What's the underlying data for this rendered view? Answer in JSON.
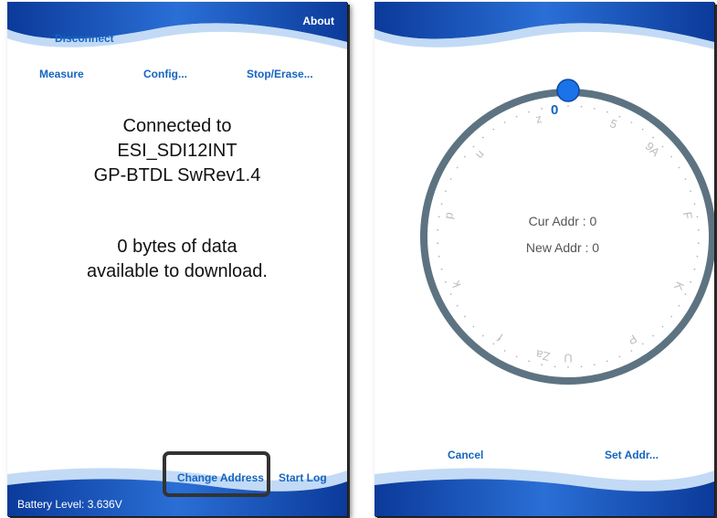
{
  "left": {
    "about_label": "About",
    "disconnect_label": "Disconnect",
    "measure_label": "Measure",
    "config_label": "Config...",
    "stop_erase_label": "Stop/Erase...",
    "connected_line1": "Connected to",
    "connected_line2": "ESI_SDI12INT",
    "connected_line3": "GP-BTDL SwRev1.4",
    "data_line1": "0 bytes of data",
    "data_line2": "available to download.",
    "change_address_label": "Change Address",
    "start_log_label": "Start Log",
    "battery_text": "Battery Level: 3.636V"
  },
  "right": {
    "dial_selected": "0",
    "dial_labels": [
      "z",
      "u",
      "p",
      "k",
      "f",
      "Za",
      "U",
      "P",
      "K",
      "F",
      "9A",
      "5"
    ],
    "cur_addr_text": "Cur Addr   : 0",
    "new_addr_text": "New Addr : 0",
    "cancel_label": "Cancel",
    "set_addr_label": "Set Addr..."
  },
  "colors": {
    "accent": "#1565c0",
    "dial_ring": "#5d7381",
    "knob": "#1a73e8",
    "wave_dark": "#0b3a9a",
    "wave_mid": "#2a6fd6",
    "wave_light": "#b7d3f3"
  }
}
